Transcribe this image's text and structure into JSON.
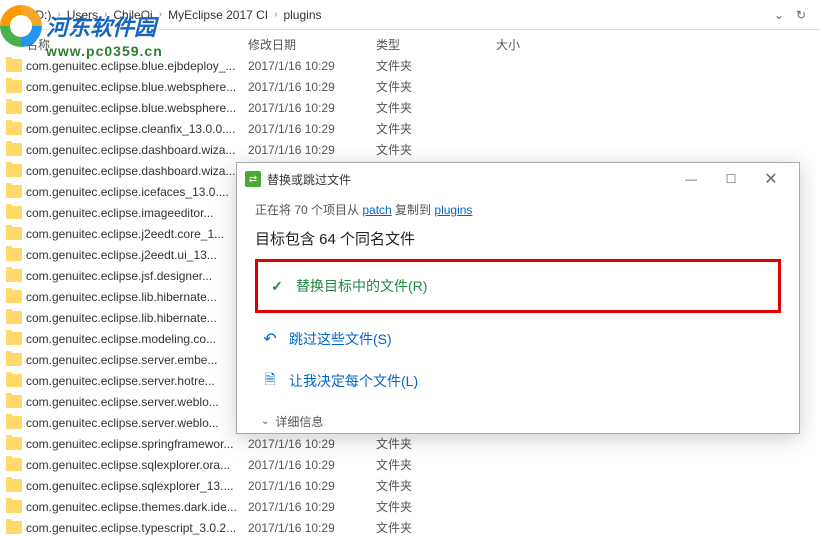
{
  "breadcrumb": {
    "items": [
      "D (D:)",
      "Users",
      "ChileQi",
      "MyEclipse 2017 CI",
      "plugins"
    ]
  },
  "columns": {
    "name": "名称",
    "date": "修改日期",
    "type": "类型",
    "size": "大小"
  },
  "watermark": {
    "text": "河东软件园",
    "url": "www.pc0359.cn"
  },
  "files": [
    {
      "name": "com.genuitec.eclipse.blue.ejbdeploy_...",
      "date": "2017/1/16 10:29",
      "type": "文件夹"
    },
    {
      "name": "com.genuitec.eclipse.blue.websphere...",
      "date": "2017/1/16 10:29",
      "type": "文件夹"
    },
    {
      "name": "com.genuitec.eclipse.blue.websphere...",
      "date": "2017/1/16 10:29",
      "type": "文件夹"
    },
    {
      "name": "com.genuitec.eclipse.cleanfix_13.0.0....",
      "date": "2017/1/16 10:29",
      "type": "文件夹"
    },
    {
      "name": "com.genuitec.eclipse.dashboard.wiza...",
      "date": "2017/1/16 10:29",
      "type": "文件夹"
    },
    {
      "name": "com.genuitec.eclipse.dashboard.wiza...",
      "date": "",
      "type": ""
    },
    {
      "name": "com.genuitec.eclipse.icefaces_13.0....",
      "date": "",
      "type": ""
    },
    {
      "name": "com.genuitec.eclipse.imageeditor...",
      "date": "",
      "type": ""
    },
    {
      "name": "com.genuitec.eclipse.j2eedt.core_1...",
      "date": "",
      "type": ""
    },
    {
      "name": "com.genuitec.eclipse.j2eedt.ui_13...",
      "date": "",
      "type": ""
    },
    {
      "name": "com.genuitec.eclipse.jsf.designer...",
      "date": "",
      "type": ""
    },
    {
      "name": "com.genuitec.eclipse.lib.hibernate...",
      "date": "",
      "type": ""
    },
    {
      "name": "com.genuitec.eclipse.lib.hibernate...",
      "date": "",
      "type": ""
    },
    {
      "name": "com.genuitec.eclipse.modeling.co...",
      "date": "",
      "type": ""
    },
    {
      "name": "com.genuitec.eclipse.server.embe...",
      "date": "",
      "type": ""
    },
    {
      "name": "com.genuitec.eclipse.server.hotre...",
      "date": "",
      "type": ""
    },
    {
      "name": "com.genuitec.eclipse.server.weblo...",
      "date": "",
      "type": ""
    },
    {
      "name": "com.genuitec.eclipse.server.weblo...",
      "date": "",
      "type": ""
    },
    {
      "name": "com.genuitec.eclipse.springframewor...",
      "date": "2017/1/16 10:29",
      "type": "文件夹"
    },
    {
      "name": "com.genuitec.eclipse.sqlexplorer.ora...",
      "date": "2017/1/16 10:29",
      "type": "文件夹"
    },
    {
      "name": "com.genuitec.eclipse.sqlexplorer_13....",
      "date": "2017/1/16 10:29",
      "type": "文件夹"
    },
    {
      "name": "com.genuitec.eclipse.themes.dark.ide...",
      "date": "2017/1/16 10:29",
      "type": "文件夹"
    },
    {
      "name": "com.genuitec.eclipse.typescript_3.0.2...",
      "date": "2017/1/16 10:29",
      "type": "文件夹"
    }
  ],
  "dialog": {
    "title": "替换或跳过文件",
    "msg_prefix": "正在将 70 个项目从 ",
    "msg_src": "patch",
    "msg_mid": " 复制到 ",
    "msg_dst": "plugins",
    "heading": "目标包含 64 个同名文件",
    "option_replace": "替换目标中的文件(R)",
    "option_skip": "跳过这些文件(S)",
    "option_decide": "让我决定每个文件(L)",
    "details": "详细信息"
  }
}
